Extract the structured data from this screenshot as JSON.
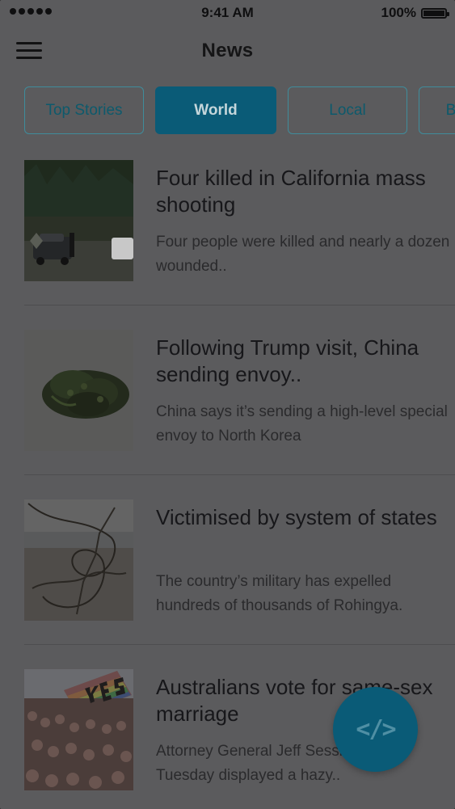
{
  "status": {
    "time": "9:41 AM",
    "battery_label": "100%",
    "signal_bars": 5
  },
  "header": {
    "title": "News"
  },
  "tabs": [
    {
      "label": "Top Stories",
      "active": false
    },
    {
      "label": "World",
      "active": true
    },
    {
      "label": "Local",
      "active": false
    },
    {
      "label": "B",
      "active": false
    }
  ],
  "articles": [
    {
      "title": "Four killed in California mass shooting",
      "summary": "Four people were killed and nearly a dozen wounded.."
    },
    {
      "title": "Following Trump visit, China sending envoy..",
      "summary": "China says it’s sending a high-level special envoy to North Korea"
    },
    {
      "title": "Victimised by system of states",
      "summary": "The country’s military has expelled hundreds of thousands of Rohingya."
    },
    {
      "title": "Australians vote for same-sex marriage",
      "summary": "Attorney General Jeff Sessions on Tuesday displayed a hazy.."
    }
  ],
  "fab": {
    "icon": "code-icon",
    "glyph": "</>"
  },
  "colors": {
    "accent": "#0a5b77",
    "tab_border": "#3f8c9b"
  }
}
